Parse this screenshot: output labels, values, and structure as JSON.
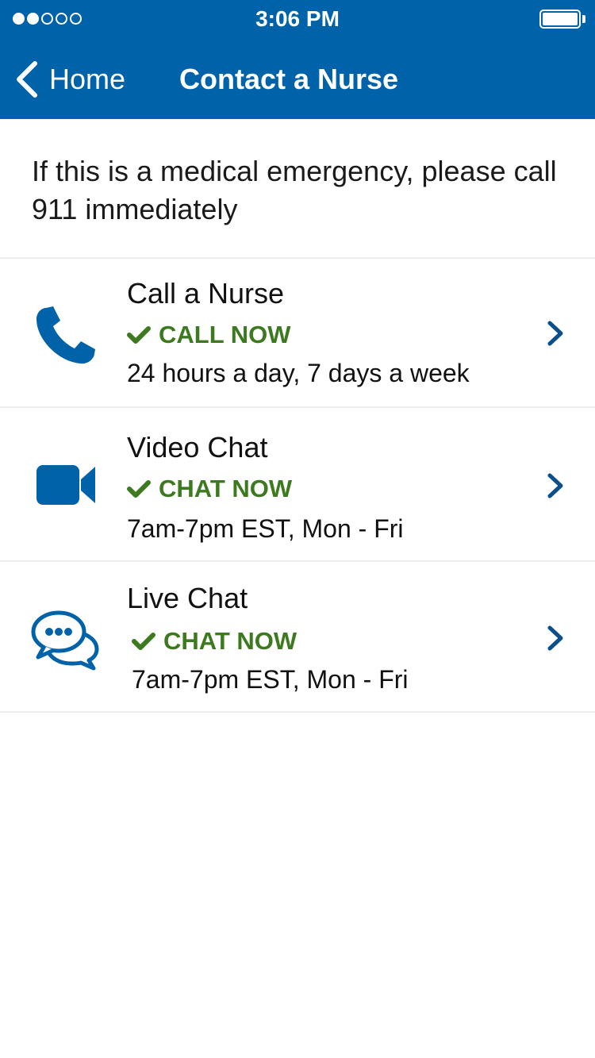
{
  "status_bar": {
    "time": "3:06 PM"
  },
  "nav": {
    "back_label": "Home",
    "title": "Contact a Nurse"
  },
  "notice": {
    "text": "If this is a medical emergency, please call 911 immediately"
  },
  "rows": [
    {
      "title": "Call a Nurse",
      "status": "CALL NOW",
      "hours": "24 hours a day, 7 days a week",
      "icon": "phone-icon"
    },
    {
      "title": "Video Chat",
      "status": "CHAT NOW",
      "hours": "7am-7pm EST, Mon - Fri",
      "icon": "video-camera-icon"
    },
    {
      "title": "Live Chat",
      "status": "CHAT NOW",
      "hours": "7am-7pm EST, Mon - Fri",
      "icon": "chat-bubbles-icon"
    }
  ],
  "colors": {
    "header": "#0062a8",
    "accent_blue": "#0062a8",
    "status_green": "#3d7a1f",
    "chevron": "#0d4f8b"
  }
}
